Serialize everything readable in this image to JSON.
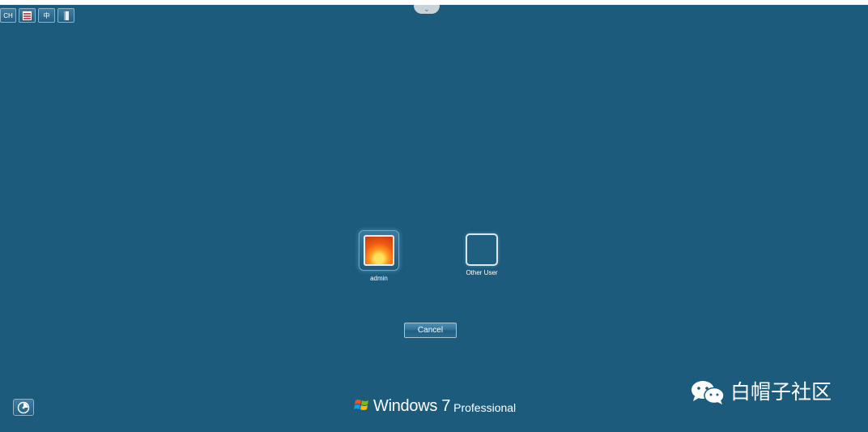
{
  "language_bar": {
    "input_language": "CH",
    "ime_mode": "中"
  },
  "users": [
    {
      "name": "admin"
    },
    {
      "name": "Other User"
    }
  ],
  "actions": {
    "cancel_label": "Cancel"
  },
  "branding": {
    "product": "Windows 7",
    "edition": "Professional"
  },
  "watermark": {
    "text": "白帽子社区"
  },
  "icons": {
    "remote_bar": "chevron-down-icon",
    "ease_of_access": "ease-of-access-icon",
    "windows_logo": "windows-flag-icon",
    "wechat_logo": "wechat-icon"
  },
  "colors": {
    "background": "#1c5b7c",
    "text": "#ffffff"
  }
}
